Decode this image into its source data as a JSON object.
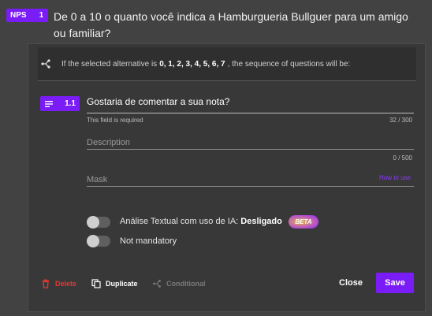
{
  "question": {
    "badge_label": "NPS",
    "badge_number": "1",
    "title": "De 0 a 10 o quanto você indica a Hamburgueria Bullguer para um amigo ou familiar?"
  },
  "logic_rule": {
    "prefix": "If the selected alternative is",
    "values": "0, 1, 2, 3, 4, 5, 6, 7",
    "suffix": ", the sequence of questions will be:"
  },
  "subquestion": {
    "number": "1.1",
    "title_value": "Gostaria de comentar a sua nota?",
    "required_hint": "This field is required",
    "title_counter": "32 / 300",
    "description_placeholder": "Description",
    "description_counter": "0 / 500",
    "mask_placeholder": "Mask",
    "mask_link": "How to use"
  },
  "toggles": {
    "ai_label": "Análise Textual com uso de IA:",
    "ai_state": "Desligado",
    "beta_label": "BETA",
    "mandatory_label": "Not mandatory"
  },
  "footer": {
    "delete_label": "Delete",
    "duplicate_label": "Duplicate",
    "conditional_label": "Conditional",
    "close_label": "Close",
    "save_label": "Save"
  },
  "colors": {
    "accent": "#7a1cf5",
    "delete": "#e53935",
    "disabled": "#7a7a7a"
  }
}
